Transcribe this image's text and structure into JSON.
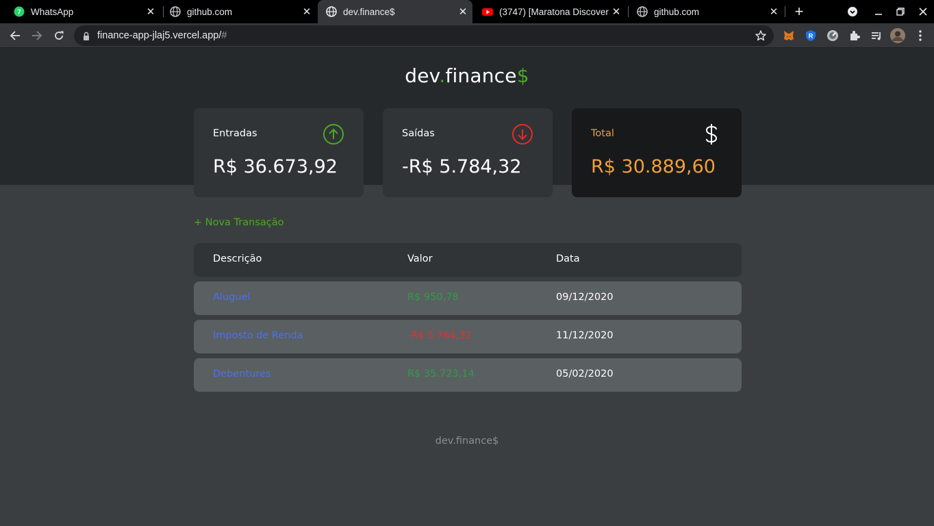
{
  "browser": {
    "tabs": [
      {
        "title": "WhatsApp",
        "icon": "whatsapp-icon"
      },
      {
        "title": "github.com",
        "icon": "globe-icon"
      },
      {
        "title": "dev.finance$",
        "icon": "globe-icon",
        "active": true
      },
      {
        "title": "(3747) [Maratona Discover",
        "icon": "youtube-icon"
      },
      {
        "title": "github.com",
        "icon": "globe-icon"
      }
    ],
    "url": {
      "host": "finance-app-jlaj5.vercel.app/",
      "fragment": "#"
    }
  },
  "header": {
    "logo_main": "dev",
    "logo_dot": ".",
    "logo_finance": "finance",
    "logo_dollar": "$"
  },
  "cards": {
    "income": {
      "label": "Entradas",
      "value": "R$ 36.673,92",
      "icon": "arrow-up-circle-icon",
      "color": "#49aa26"
    },
    "expense": {
      "label": "Saídas",
      "value": "-R$ 5.784,32",
      "icon": "arrow-down-circle-icon",
      "color": "#e92929"
    },
    "total": {
      "label": "Total",
      "value": "R$ 30.889,60",
      "icon": "dollar-icon",
      "color": "#f0a038"
    }
  },
  "new_transaction": "+ Nova Transação",
  "table": {
    "headers": {
      "description": "Descrição",
      "amount": "Valor",
      "date": "Data"
    },
    "rows": [
      {
        "description": "Aluguel",
        "amount": "R$ 950,78",
        "date": "09/12/2020",
        "type": "income"
      },
      {
        "description": "Imposto de Renda",
        "amount": "-R$ 5.784,32",
        "date": "11/12/2020",
        "type": "expense"
      },
      {
        "description": "Debentures",
        "amount": "R$ 35.723,14",
        "date": "05/02/2020",
        "type": "income"
      }
    ]
  },
  "footer": "dev.finance$",
  "colors": {
    "accent_green": "#49aa26",
    "total_orange": "#f0a038",
    "link_blue": "#4c6ef5",
    "expense_red": "#e03131"
  }
}
